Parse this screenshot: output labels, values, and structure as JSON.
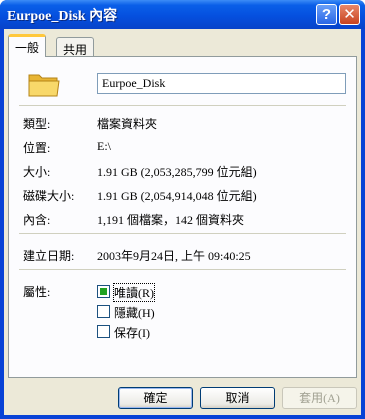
{
  "window": {
    "title": "Eurpoe_Disk 內容",
    "help_glyph": "?",
    "close_glyph": "✕"
  },
  "tabs": [
    {
      "label": "一般"
    },
    {
      "label": "共用"
    }
  ],
  "general": {
    "name_value": "Eurpoe_Disk",
    "type_label": "類型:",
    "type_value": "檔案資料夾",
    "location_label": "位置:",
    "location_value": "E:\\",
    "size_label": "大小:",
    "size_value": "1.91 GB (2,053,285,799 位元組)",
    "size_on_disk_label": "磁碟大小:",
    "size_on_disk_value": "1.91 GB (2,054,914,048 位元組)",
    "contains_label": "內含:",
    "contains_value": "1,191 個檔案，142 個資料夾",
    "created_label": "建立日期:",
    "created_value": "2003年9月24日, 上午 09:40:25",
    "attributes_label": "屬性:",
    "attributes": [
      {
        "label": "唯讀(R)",
        "state": "indeterminate"
      },
      {
        "label": "隱藏(H)",
        "state": "unchecked"
      },
      {
        "label": "保存(I)",
        "state": "unchecked"
      }
    ]
  },
  "buttons": {
    "ok": "確定",
    "cancel": "取消",
    "apply": "套用(A)"
  },
  "colors": {
    "title_bar": "#0550df",
    "dialog_bg": "#ece9d8",
    "tab_highlight": "#ffc83c",
    "indeterminate_fill": "#21a121"
  }
}
